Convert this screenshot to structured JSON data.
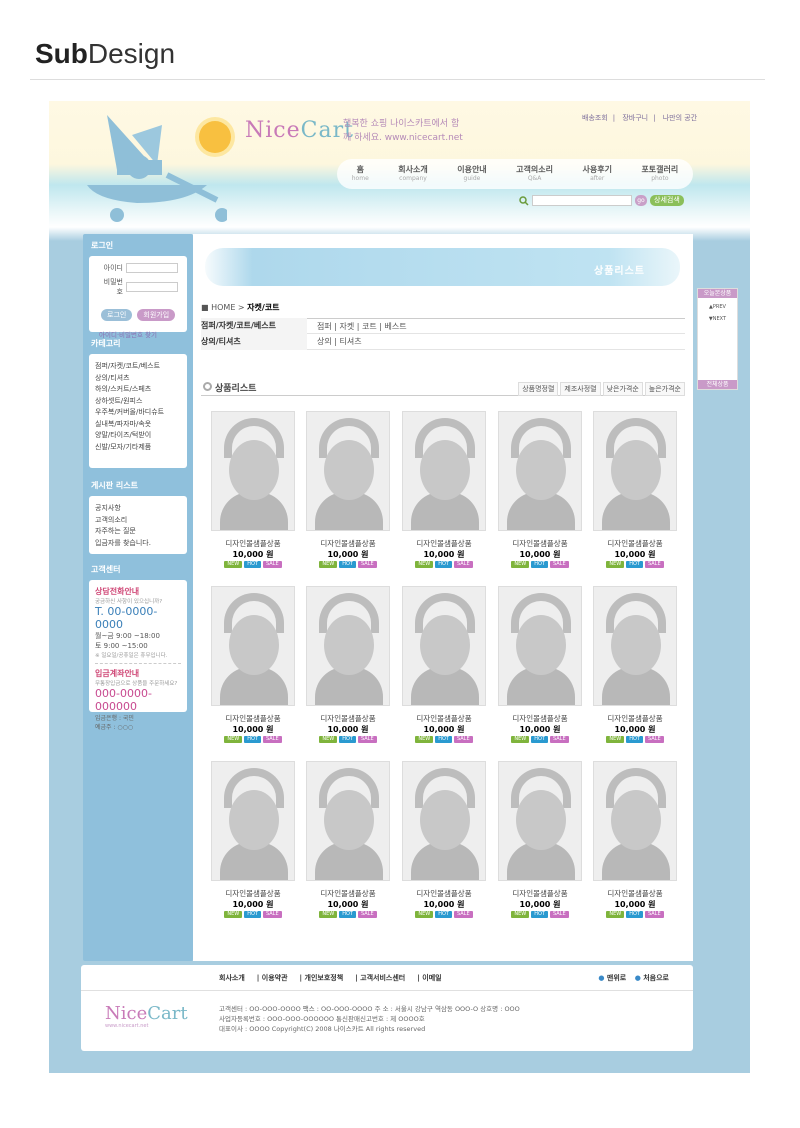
{
  "heading": {
    "bold": "Sub",
    "rest": "Design"
  },
  "header": {
    "logo_a": "Nice",
    "logo_b": "Cart",
    "slogan": "행복한 쇼핑 나이스카트에서 함께 하세요. www.nicecart.net",
    "top_links": [
      "배송조회",
      "장바구니",
      "나만의 공간"
    ],
    "nav": [
      {
        "label": "홈",
        "sub": "home"
      },
      {
        "label": "회사소개",
        "sub": "company"
      },
      {
        "label": "이용안내",
        "sub": "guide"
      },
      {
        "label": "고객의소리",
        "sub": "Q&A"
      },
      {
        "label": "사용후기",
        "sub": "after"
      },
      {
        "label": "포토갤러리",
        "sub": "photo"
      }
    ],
    "search_go": "go",
    "search_adv": "상세검색"
  },
  "sidebar": {
    "login_title": "로그인",
    "id_label": "아이디",
    "pw_label": "비밀번호",
    "login_btn": "로그인",
    "join_btn": "회원가입",
    "find": "아이디·비밀번호 찾기",
    "category_title": "카테고리",
    "categories": [
      "점퍼/자켓/코트/베스트",
      "상의/티셔츠",
      "하의/스커트/스페츠",
      "상하셋트/원피스",
      "우주복/커버올/바디슈트",
      "실내복/파자마/속옷",
      "양말/타이즈/턱받이",
      "신발/모자/기타제품"
    ],
    "board_title": "게시판 리스트",
    "boards": [
      "공지사항",
      "고객의소리",
      "자주하는 질문",
      "입금자를 찾습니다."
    ],
    "cs_title": "고객센터",
    "cs_phone_title": "상담전화안내",
    "cs_phone_sub": "궁금하신 사항이 있으십니까?",
    "cs_phone": "T. 00-0000-0000",
    "cs_hours1": "월~금 9:00 ~18:00",
    "cs_hours2": "토 9:00 ~15:00",
    "cs_holiday": "※ 일요일/공휴일은 휴무입니다.",
    "cs_bank_title": "입금계좌안내",
    "cs_bank_sub": "무통장입금으로 상품을 주문하세요?",
    "cs_account": "000-0000-000000",
    "cs_bank": "입금은행 : 국민",
    "cs_owner": "예금주 : ○○○"
  },
  "main": {
    "banner": "상품리스트",
    "crumb_home": "HOME >",
    "crumb_current": "자켓/코트",
    "cat_rows": [
      {
        "key": "점퍼/자켓/코트/베스트",
        "val": "점퍼  |  자켓  |  코트  |  베스트"
      },
      {
        "key": "상의/티셔츠",
        "val": "상의  |  티셔츠"
      }
    ],
    "list_title": "상품리스트",
    "sorts": [
      "상품명정렬",
      "제조사정렬",
      "낮은가격순",
      "높은가격순"
    ],
    "product_name": "디자인몰샘플상품",
    "product_price": "10,000 원",
    "badges": [
      "NEW",
      "HOT",
      "SALE"
    ]
  },
  "right": {
    "title": "오늘본상품",
    "prev": "▲PREV",
    "next": "▼NEXT",
    "bottom": "전체상품"
  },
  "footer": {
    "links": [
      "회사소개",
      "이용약관",
      "개인보호정책",
      "고객서비스센터",
      "이메일"
    ],
    "top": "맨위로",
    "home": "처음으로",
    "logo_a": "Nice",
    "logo_b": "Cart",
    "logo_sub": "www.nicecart.net",
    "info1": "고객센터 : OO-OOO-OOOO      팩스 : OO-OOO-OOOO      주 소 : 서울시 강남구 역삼동 OOO-O    상호명 : OOO",
    "info2": "사업자등록번호 : OOO-OOO-OOOOOO      통신판매신고번호 : 제 OOOO호",
    "info3": "대표이사 : OOOO      Copyright(C) 2008 나이스카트 All rights reserved"
  }
}
